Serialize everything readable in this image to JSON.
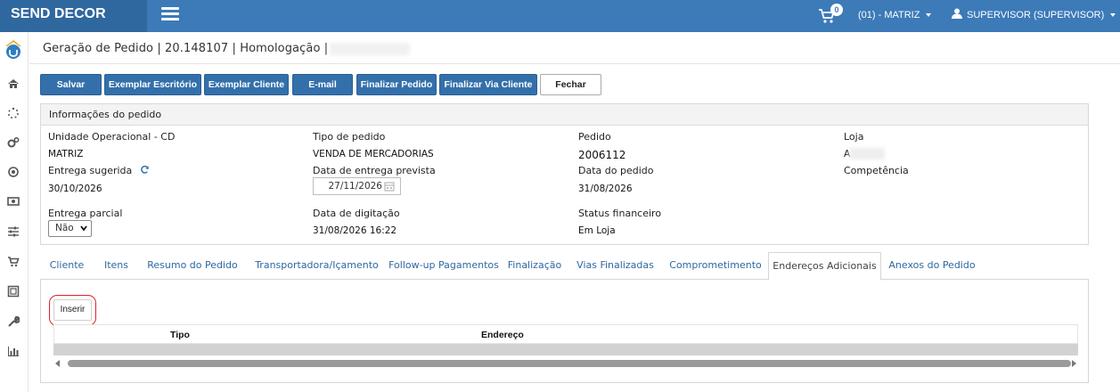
{
  "app": {
    "brand": "SEND DECOR"
  },
  "topbar": {
    "cart_count": "0",
    "store_selector": "(01) - MATRIZ",
    "user_menu": "SUPERVISOR (SUPERVISOR)"
  },
  "breadcrumb": {
    "text": "Geração de Pedido | 20.148107 | Homologação |"
  },
  "toolbar": {
    "save": "Salvar",
    "office_copy": "Exemplar Escritório",
    "client_copy": "Exemplar Cliente",
    "email": "E-mail",
    "finalize": "Finalizar Pedido",
    "finalize_client": "Finalizar Via Cliente",
    "close": "Fechar"
  },
  "info": {
    "title": "Informações do pedido",
    "unit_label": "Unidade Operacional - CD",
    "unit_value": "MATRIZ",
    "order_type_label": "Tipo de pedido",
    "order_type_value": "VENDA DE MERCADORIAS",
    "order_label": "Pedido",
    "order_value": "2006112",
    "store_label": "Loja",
    "store_value": "A",
    "suggested_delivery_label": "Entrega sugerida",
    "suggested_delivery_value": "30/10/2026",
    "expected_delivery_label": "Data de entrega prevista",
    "expected_delivery_value": "27/11/2026",
    "order_date_label": "Data do pedido",
    "order_date_value": "31/08/2026",
    "competence_label": "Competência",
    "partial_delivery_label": "Entrega parcial",
    "partial_delivery_value": "Não",
    "typing_date_label": "Data de digitação",
    "typing_date_value": "31/08/2026 16:22",
    "financial_status_label": "Status financeiro",
    "financial_status_value": "Em Loja"
  },
  "tabs": [
    {
      "label": "Cliente"
    },
    {
      "label": "Itens"
    },
    {
      "label": "Resumo do Pedido"
    },
    {
      "label": "Transportadora/Içamento"
    },
    {
      "label": "Follow-up Pagamentos"
    },
    {
      "label": "Finalização"
    },
    {
      "label": "Vias Finalizadas"
    },
    {
      "label": "Comprometimento"
    },
    {
      "label": "Endereços Adicionais"
    },
    {
      "label": "Anexos do Pedido"
    }
  ],
  "active_tab": "Endereços Adicionais",
  "addresses": {
    "insert_label": "Inserir",
    "columns": [
      "Tipo",
      "Endereço"
    ]
  },
  "colors": {
    "topbar": "#3c7ab8",
    "brand_bg": "#2f679f",
    "button": "#3370ab",
    "highlight": "#e0222a",
    "link": "#2f68a3"
  },
  "icons": {
    "sidebar": [
      "logo-icon",
      "home-icon",
      "loading-icon",
      "settings-icon",
      "target-icon",
      "money-icon",
      "sliders-icon",
      "cart-icon",
      "image-icon",
      "wrench-icon",
      "chart-icon"
    ]
  }
}
